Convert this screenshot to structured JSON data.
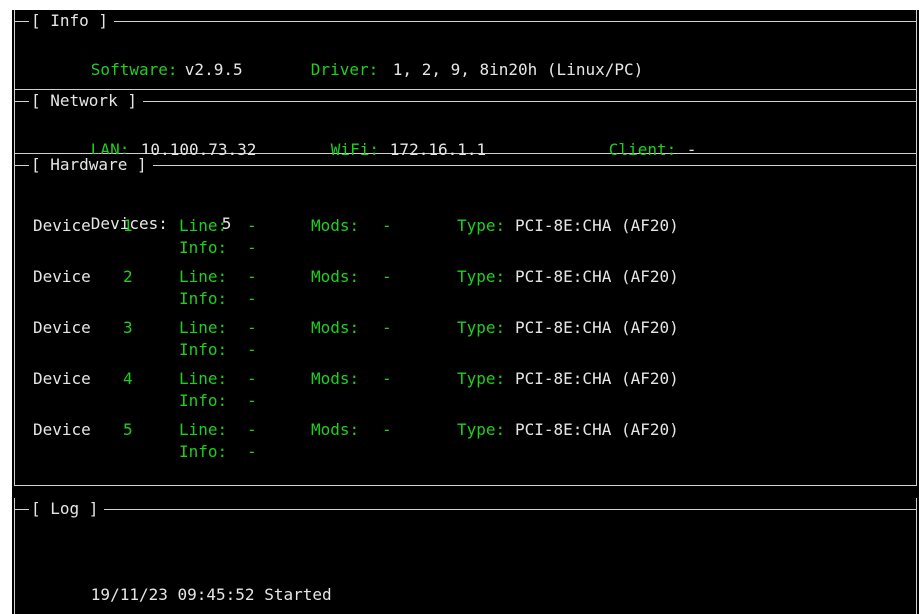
{
  "info": {
    "title": "[ Info ]",
    "software_label": "Software:",
    "software_value": "v2.9.5",
    "driver_label": "Driver:",
    "driver_value": "1, 2, 9, 8in20h (Linux/PC)"
  },
  "network": {
    "title": "[ Network ]",
    "lan_label": "LAN:",
    "lan_value": "10.100.73.32",
    "wifi_label": "WiFi:",
    "wifi_value": "172.16.1.1",
    "client_label": "Client:",
    "client_value": "-"
  },
  "hardware": {
    "title": "[ Hardware ]",
    "devices_label": "Devices:",
    "devices_count": "5",
    "device_word": "Device",
    "devices": [
      {
        "num": "1",
        "line_label": "Line:",
        "line_value": "-",
        "mods_label": "Mods:",
        "mods_value": "-",
        "type_label": "Type:",
        "type_value": "PCI-8E:CHA (AF20)",
        "info_label": "Info:",
        "info_value": "-"
      },
      {
        "num": "2",
        "line_label": "Line:",
        "line_value": "-",
        "mods_label": "Mods:",
        "mods_value": "-",
        "type_label": "Type:",
        "type_value": "PCI-8E:CHA (AF20)",
        "info_label": "Info:",
        "info_value": "-"
      },
      {
        "num": "3",
        "line_label": "Line:",
        "line_value": "-",
        "mods_label": "Mods:",
        "mods_value": "-",
        "type_label": "Type:",
        "type_value": "PCI-8E:CHA (AF20)",
        "info_label": "Info:",
        "info_value": "-"
      },
      {
        "num": "4",
        "line_label": "Line:",
        "line_value": "-",
        "mods_label": "Mods:",
        "mods_value": "-",
        "type_label": "Type:",
        "type_value": "PCI-8E:CHA (AF20)",
        "info_label": "Info:",
        "info_value": "-"
      },
      {
        "num": "5",
        "line_label": "Line:",
        "line_value": "-",
        "mods_label": "Mods:",
        "mods_value": "-",
        "type_label": "Type:",
        "type_value": "PCI-8E:CHA (AF20)",
        "info_label": "Info:",
        "info_value": "-"
      }
    ]
  },
  "log": {
    "title": "[ Log ]",
    "entries": [
      "19/11/23 09:45:52 Started"
    ]
  },
  "colors": {
    "background": "#000000",
    "label_green": "#1ed01e",
    "text": "#e6e6e6",
    "border": "#cfcfcf"
  }
}
